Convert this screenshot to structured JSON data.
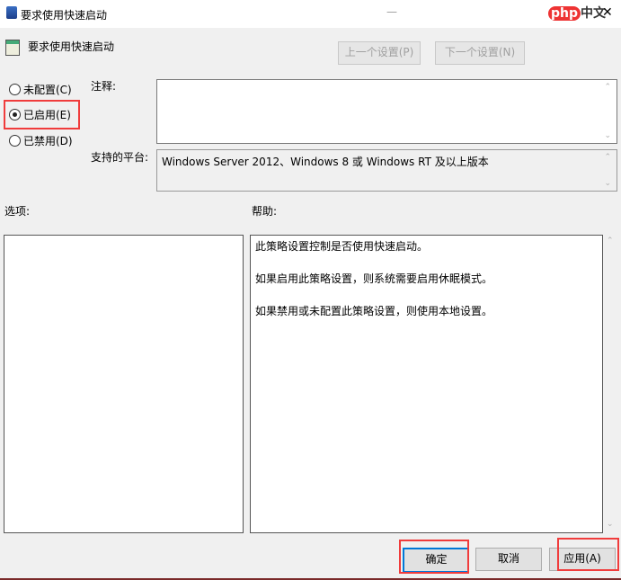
{
  "window": {
    "title": "要求使用快速启动",
    "minimize": "—",
    "close": "✕",
    "watermark": "php中文网"
  },
  "header": {
    "title": "要求使用快速启动",
    "prev_button": "上一个设置(P)",
    "next_button": "下一个设置(N)"
  },
  "state": {
    "options": [
      {
        "label": "未配置(C)",
        "selected": false
      },
      {
        "label": "已启用(E)",
        "selected": true
      },
      {
        "label": "已禁用(D)",
        "selected": false
      }
    ]
  },
  "comment": {
    "label": "注释:",
    "value": ""
  },
  "platform": {
    "label": "支持的平台:",
    "value": "Windows Server 2012、Windows 8 或 Windows RT 及以上版本"
  },
  "options_label": "选项:",
  "help": {
    "label": "帮助:",
    "paragraphs": [
      "此策略设置控制是否使用快速启动。",
      "如果启用此策略设置，则系统需要启用休眠模式。",
      "如果禁用或未配置此策略设置，则使用本地设置。"
    ]
  },
  "footer": {
    "ok": "确定",
    "cancel": "取消",
    "apply": "应用(A)"
  },
  "colors": {
    "highlight": "#f03c3c",
    "focus": "#0078d7"
  }
}
